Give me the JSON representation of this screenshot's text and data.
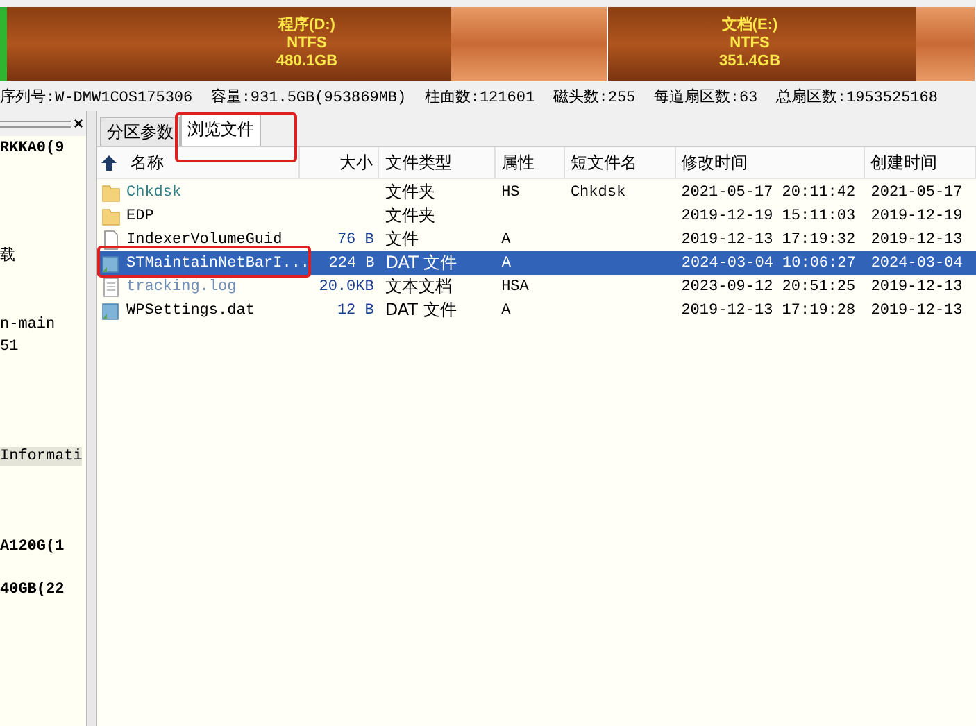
{
  "disk_map": {
    "partitions": [
      {
        "label": "程序(D:)",
        "filesystem": "NTFS",
        "size": "480.1GB",
        "level": 0.74
      },
      {
        "label": "文档(E:)",
        "filesystem": "NTFS",
        "size": "351.4GB",
        "level": 0.84
      }
    ]
  },
  "disk_info": "序列号:W-DMW1COS175306  容量:931.5GB(953869MB)  柱面数:121601  磁头数:255  每道扇区数:63  总扇区数:1953525168",
  "left_panel": {
    "close": "×",
    "items": [
      {
        "text": "RKKA0(9",
        "bold": true,
        "selected": false
      },
      {
        "text": "载",
        "bold": false,
        "selected": false
      },
      {
        "text": "n-main",
        "bold": false,
        "selected": false
      },
      {
        "text": "51",
        "bold": false,
        "selected": false
      },
      {
        "text": "Informati",
        "bold": false,
        "selected": true
      },
      {
        "text": "A120G(1",
        "bold": true,
        "selected": false
      },
      {
        "text": "40GB(22",
        "bold": true,
        "selected": false
      }
    ]
  },
  "tabs": [
    {
      "label": "分区参数",
      "selected": false
    },
    {
      "label": "浏览文件",
      "selected": true,
      "highlighted": true
    }
  ],
  "table": {
    "columns": [
      "名称",
      "大小",
      "文件类型",
      "属性",
      "短文件名",
      "修改时间",
      "创建时间"
    ],
    "rows": [
      {
        "kind": "folder",
        "name": "Chkdsk",
        "color": "#2f7f86",
        "size": "",
        "type": "文件夹",
        "attr": "HS",
        "short": "Chkdsk",
        "modified": "2021-05-17 20:11:42",
        "created": "2021-05-17",
        "selected": false,
        "highlighted": false
      },
      {
        "kind": "folder",
        "name": "EDP",
        "color": "#000000",
        "size": "",
        "type": "文件夹",
        "attr": "",
        "short": "",
        "modified": "2019-12-19 15:11:03",
        "created": "2019-12-19",
        "selected": false,
        "highlighted": false
      },
      {
        "kind": "file",
        "name": "IndexerVolumeGuid",
        "color": "#000000",
        "size": "76 B",
        "type": "文件",
        "attr": "A",
        "short": "",
        "modified": "2019-12-13 17:19:32",
        "created": "2019-12-13",
        "selected": false,
        "highlighted": false
      },
      {
        "kind": "dat",
        "name": "STMaintainNetBarI...",
        "color": "#ffffff",
        "size": "224 B",
        "type": "DAT 文件",
        "attr": "A",
        "short": "",
        "modified": "2024-03-04 10:06:27",
        "created": "2024-03-04",
        "selected": true,
        "highlighted": true
      },
      {
        "kind": "text",
        "name": "tracking.log",
        "color": "#6f8fb8",
        "size": "20.0KB",
        "type": "文本文档",
        "attr": "HSA",
        "short": "",
        "modified": "2023-09-12 20:51:25",
        "created": "2019-12-13",
        "selected": false,
        "highlighted": false
      },
      {
        "kind": "dat",
        "name": "WPSettings.dat",
        "color": "#000000",
        "size": "12 B",
        "type": "DAT 文件",
        "attr": "A",
        "short": "",
        "modified": "2019-12-13 17:19:28",
        "created": "2019-12-13",
        "selected": false,
        "highlighted": false
      }
    ]
  }
}
